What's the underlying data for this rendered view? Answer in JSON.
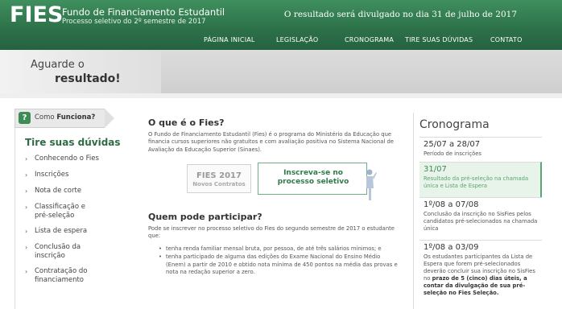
{
  "header": {
    "logo": "FIES",
    "title": "Fundo de Financiamento Estudantil",
    "subtitle": "Processo seletivo do 2º semestre de 2017",
    "announcement": "O resultado será divulgado no dia 31 de julho de 2017"
  },
  "nav": {
    "items": [
      "PÁGINA INICIAL",
      "LEGISLAÇÃO",
      "CRONOGRAMA",
      "TIRE SUAS DÚVIDAS",
      "CONTATO"
    ]
  },
  "banner": {
    "line1": "Aguarde o",
    "line2": "resultado!"
  },
  "sidebar": {
    "how_prefix": "Como",
    "how_bold": "Funciona?",
    "title": "Tire suas dúvidas",
    "items": [
      [
        "Conhecendo o Fies"
      ],
      [
        "Inscrições"
      ],
      [
        "Nota de corte"
      ],
      [
        "Classificação e",
        "pré-seleção"
      ],
      [
        "Lista de espera"
      ],
      [
        "Conclusão da",
        "inscrição"
      ],
      [
        "Contratação do",
        "financiamento"
      ]
    ]
  },
  "main": {
    "what_title": "O que é o Fies?",
    "what_text": "O Fundo de Financiamento Estudantil (Fies) é o programa do Ministério da Educação que financia cursos superiores não gratuitos e com avaliação positiva no Sistema Nacional de Avaliação da Educação Superior (Sinaes).",
    "fies_box_line1": "FIES 2017",
    "fies_box_line2": "Novos Contratos",
    "subscribe_button": "Inscreva-se no processo seletivo",
    "who_title": "Quem pode participar?",
    "who_intro": "Pode se inscrever no processo seletivo do Fies do segundo semestre de 2017 o estudante que:",
    "requirements": [
      "tenha renda familiar mensal bruta, por pessoa, de até três salários mínimos; e",
      "tenha participado de alguma das edições do Exame Nacional do Ensino Médio (Enem) a partir de 2010 e obtido nota mínima de 450 pontos na média das provas e nota na redação superior a zero."
    ]
  },
  "schedule": {
    "title": "Cronograma",
    "entries": [
      {
        "date": "25/07 a 28/07",
        "desc": "Período de inscrições"
      },
      {
        "date": "31/07",
        "desc": "Resultado da pré-seleção na chamada única e Lista de Espera"
      },
      {
        "date": "1º/08 a 07/08",
        "desc": "Conclusão da inscrição no SisFies pelos candidatos pré-selecionados na chamada única"
      },
      {
        "date": "1º/08 a 03/09",
        "desc_pre": "Os estudantes participantes da Lista de Espera que forem pré-selecionados deverão concluir sua inscrição no SisFies no",
        "desc_bold": "prazo de 5 (cinco) dias úteis, a contar da divulgação de sua pré-seleção no Fies Seleção."
      }
    ]
  },
  "colors": {
    "header_green": "#2c7048",
    "accent_green": "#3f8a57",
    "highlight_bg": "#e8f3ea"
  }
}
